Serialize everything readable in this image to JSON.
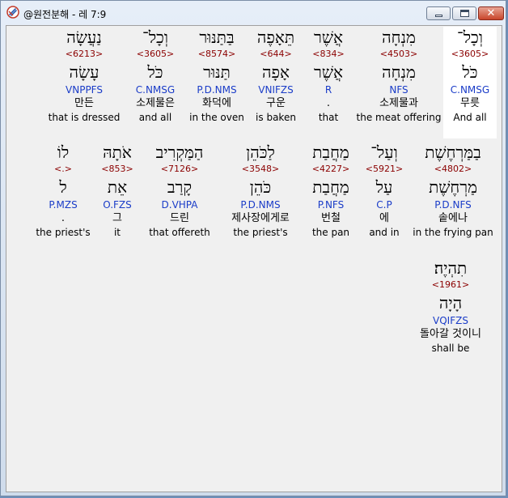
{
  "window": {
    "title": "@원전분해 - 레 7:9",
    "icons": {
      "app": "bible-app-icon",
      "minimize": "minimize-icon",
      "maximize": "maximize-icon",
      "close": "close-icon"
    },
    "close_glyph": "✕"
  },
  "words": [
    {
      "hebrew": "וְכָל־",
      "strong": "<3605>",
      "lemma": "כֹּל",
      "morph": "C.NMSG",
      "korean": "무릇",
      "english": "And all",
      "selected": true
    },
    {
      "hebrew": "מִנְחָה",
      "strong": "<4503>",
      "lemma": "מִנְחָה",
      "morph": "NFS",
      "korean": "소제물과",
      "english": "the meat offering"
    },
    {
      "hebrew": "אֲשֶׁר",
      "strong": "<834>",
      "lemma": "אֲשֶׁר",
      "morph": "R",
      "korean": ".",
      "english": "that"
    },
    {
      "hebrew": "תֵּאָפֶה",
      "strong": "<644>",
      "lemma": "אָפָה",
      "morph": "VNIFZS",
      "korean": "구운",
      "english": "is baken"
    },
    {
      "hebrew": "בַּתַּנּוּר",
      "strong": "<8574>",
      "lemma": "תַּנּוּר",
      "morph": "P.D.NMS",
      "korean": "화덕에",
      "english": "in the oven"
    },
    {
      "hebrew": "וְכָל־",
      "strong": "<3605>",
      "lemma": "כֹּל",
      "morph": "C.NMSG",
      "korean": "소제물은",
      "english": "and all"
    },
    {
      "hebrew": "נַעֲשָׂה",
      "strong": "<6213>",
      "lemma": "עָשָׂה",
      "morph": "VNPPFS",
      "korean": "만든",
      "english": "that is dressed"
    },
    {
      "hebrew": "בַמַּרְחֶשֶׁת",
      "strong": "<4802>",
      "lemma": "מַרְחֶשֶׁת",
      "morph": "P.D.NFS",
      "korean": "솥에나",
      "english": "in the frying pan"
    },
    {
      "hebrew": "וְעַל־",
      "strong": "<5921>",
      "lemma": "עַל",
      "morph": "C.P",
      "korean": "에",
      "english": "and in"
    },
    {
      "hebrew": "מַחֲבַת",
      "strong": "<4227>",
      "lemma": "מַחֲבַת",
      "morph": "P.NFS",
      "korean": "번철",
      "english": "the pan"
    },
    {
      "hebrew": "לַכֹּהֵן",
      "strong": "<3548>",
      "lemma": "כֹּהֵן",
      "morph": "P.D.NMS",
      "korean": "제사장에게로",
      "english": "the priest's"
    },
    {
      "hebrew": "הַמַּקְרִיב",
      "strong": "<7126>",
      "lemma": "קָרַב",
      "morph": "D.VHPA",
      "korean": "드린",
      "english": "that offereth"
    },
    {
      "hebrew": "אֹתָהּ",
      "strong": "<853>",
      "lemma": "אֵת",
      "morph": "O.FZS",
      "korean": "그",
      "english": "it"
    },
    {
      "hebrew": "לוֹ",
      "strong": "<.>",
      "lemma": "ל",
      "morph": "P.MZS",
      "korean": ".",
      "english": "the priest's"
    },
    {
      "hebrew": "תִהְיֶה׃",
      "strong": "<1961>",
      "lemma": "הָיָה",
      "morph": "VQIFZS",
      "korean": "돌아갈 것이니",
      "english": "shall be"
    }
  ]
}
